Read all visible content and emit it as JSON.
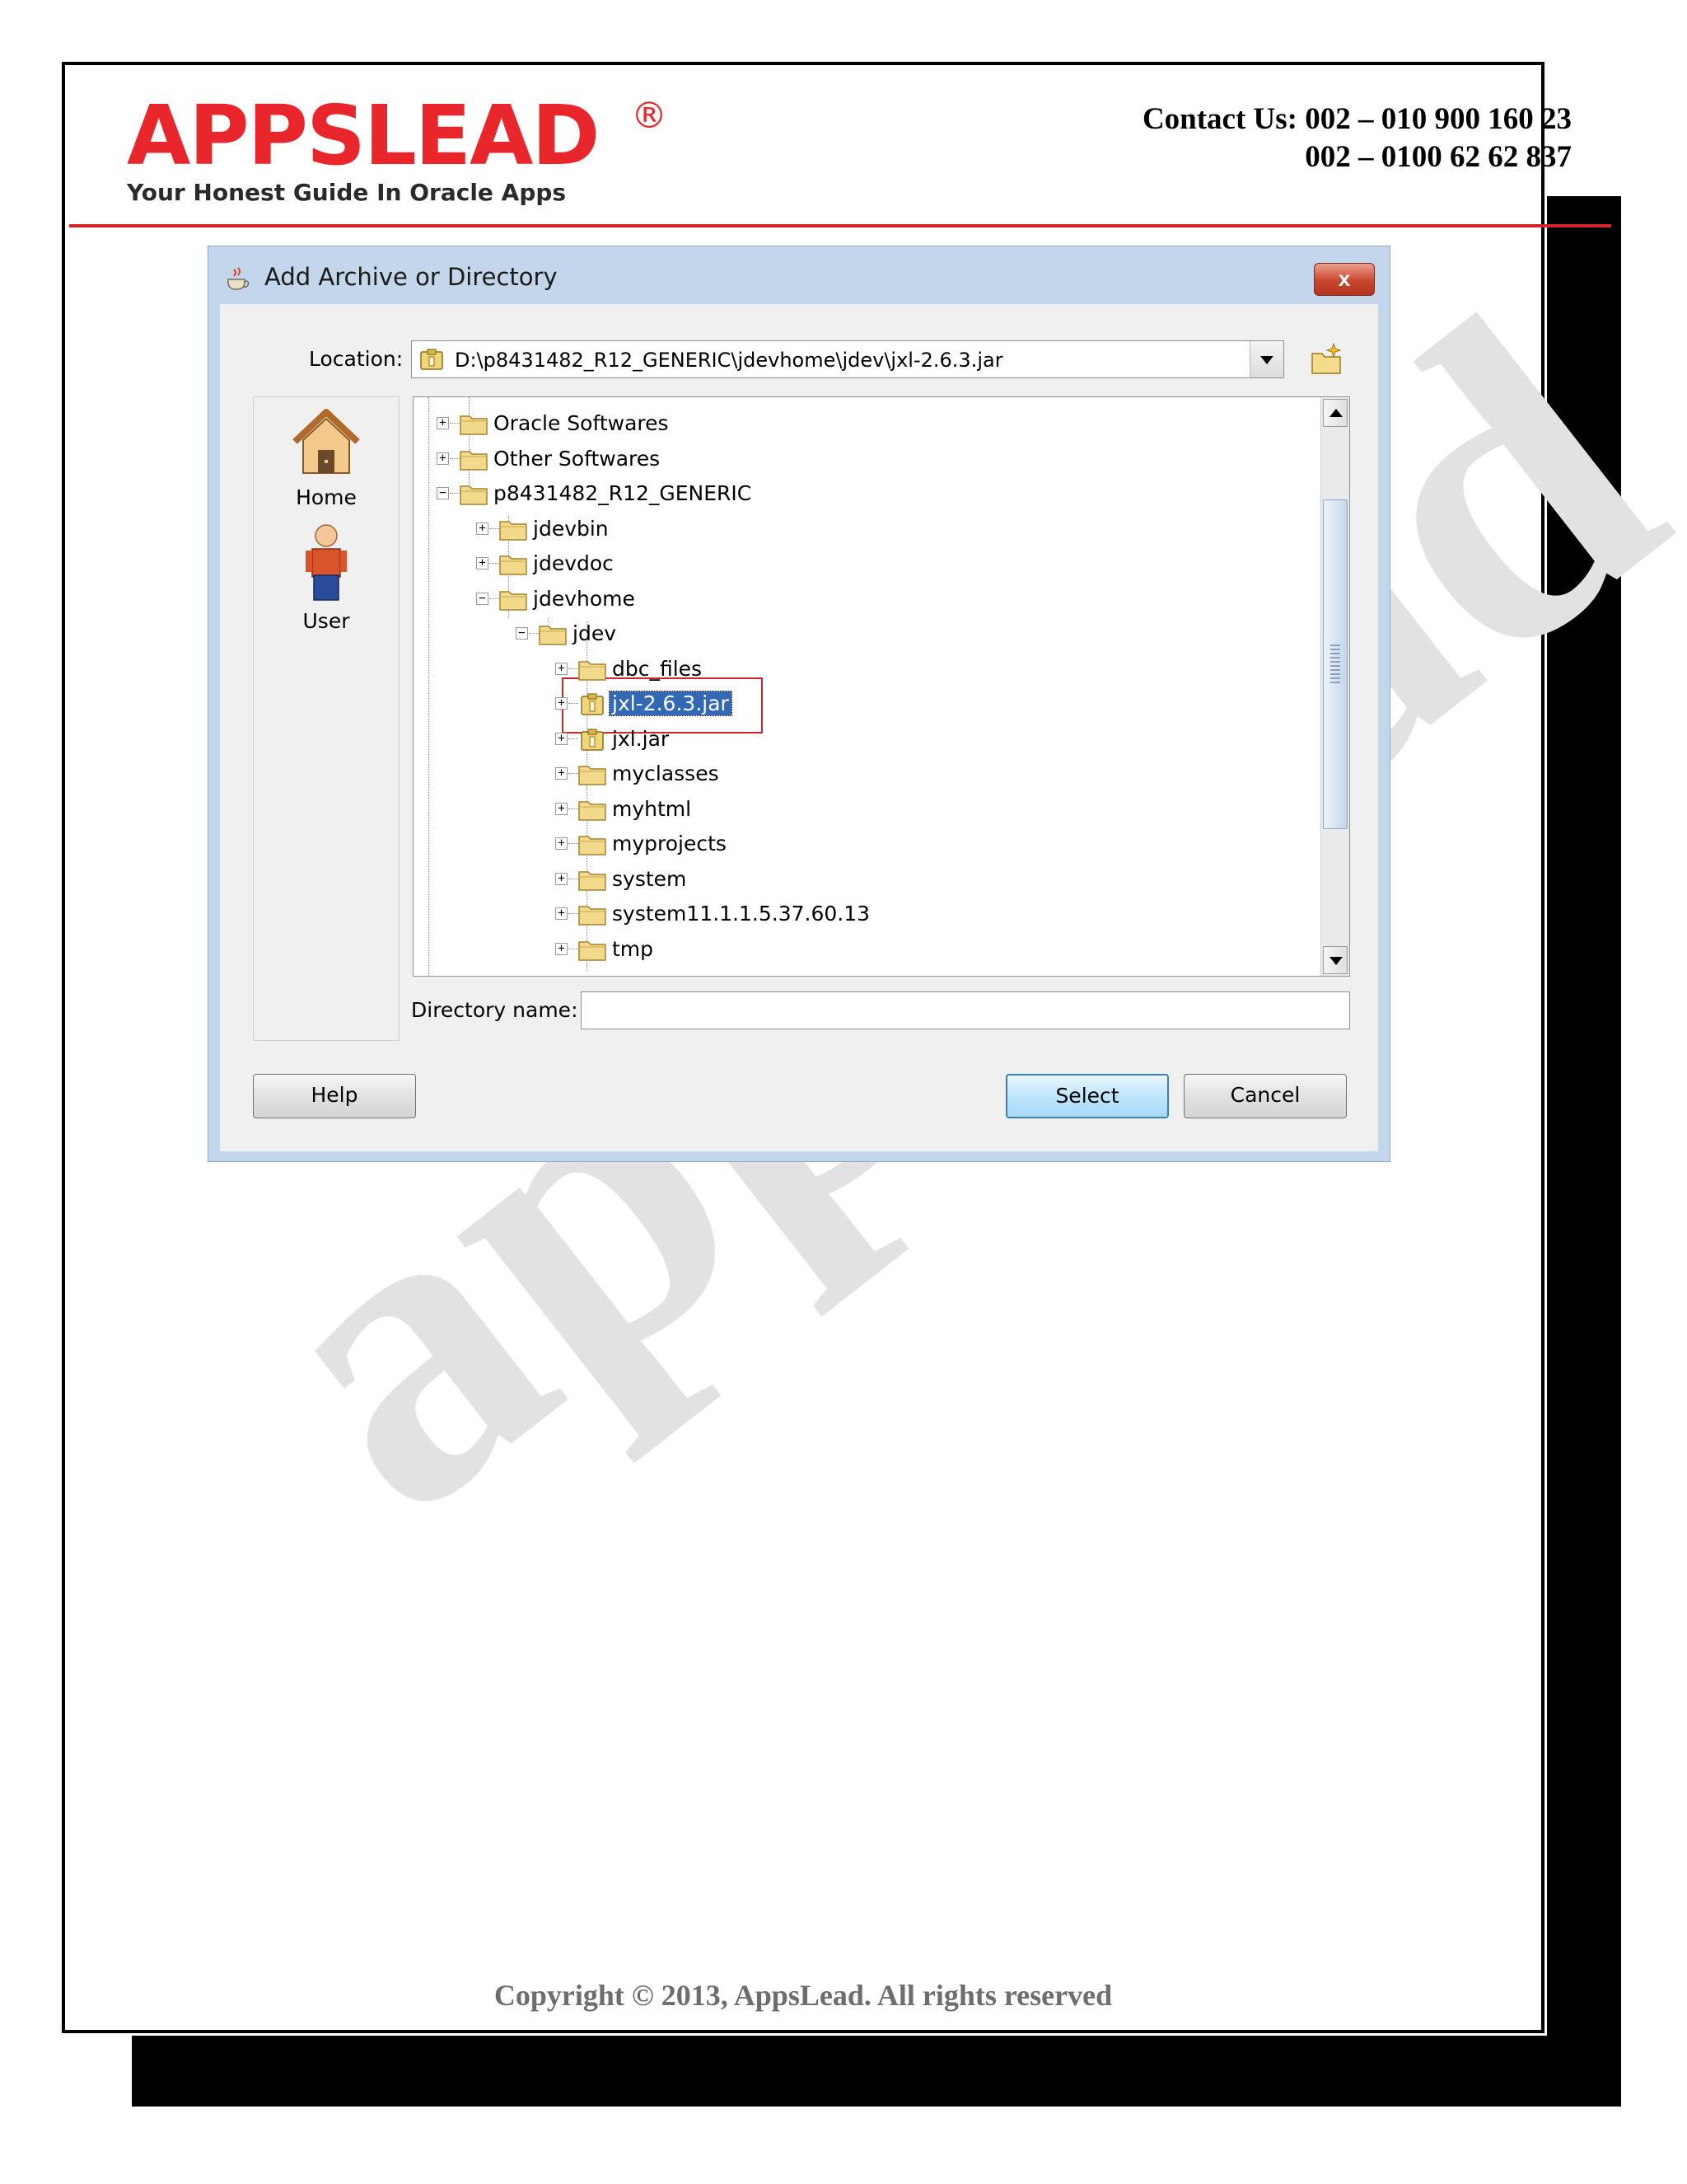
{
  "header": {
    "logo_text": "APPSLEAD",
    "logo_registered": "®",
    "tagline": "Your Honest Guide In Oracle Apps",
    "contact_line1": "Contact Us: 002 – 010 900 160 23",
    "contact_line2": "002 – 0100 62 62 837",
    "brand_color": "#e8262b"
  },
  "watermark": "appslead",
  "footer": {
    "copyright": "Copyright © 2013, AppsLead. All rights reserved"
  },
  "dialog": {
    "title": "Add Archive or Directory",
    "close_label": "x",
    "location_label": "Location:",
    "location_value": "D:\\p8431482_R12_GENERIC\\jdevhome\\jdev\\jxl-2.6.3.jar",
    "places": [
      {
        "label": "Home",
        "icon": "home-icon"
      },
      {
        "label": "User",
        "icon": "user-icon"
      }
    ],
    "tree": [
      {
        "label": "Oracle Softwares",
        "level": 0,
        "expander": "+",
        "icon": "folder-icon"
      },
      {
        "label": "Other Softwares",
        "level": 0,
        "expander": "+",
        "icon": "folder-icon"
      },
      {
        "label": "p8431482_R12_GENERIC",
        "level": 0,
        "expander": "-",
        "icon": "folder-icon"
      },
      {
        "label": "jdevbin",
        "level": 1,
        "expander": "+",
        "icon": "folder-icon"
      },
      {
        "label": "jdevdoc",
        "level": 1,
        "expander": "+",
        "icon": "folder-icon"
      },
      {
        "label": "jdevhome",
        "level": 1,
        "expander": "-",
        "icon": "folder-icon"
      },
      {
        "label": "jdev",
        "level": 2,
        "expander": "-",
        "icon": "folder-icon"
      },
      {
        "label": "dbc_files",
        "level": 3,
        "expander": "+",
        "icon": "folder-icon"
      },
      {
        "label": "jxl-2.6.3.jar",
        "level": 3,
        "expander": "+",
        "icon": "jar-icon",
        "selected": true
      },
      {
        "label": "jxl.jar",
        "level": 3,
        "expander": "+",
        "icon": "jar-icon"
      },
      {
        "label": "myclasses",
        "level": 3,
        "expander": "+",
        "icon": "folder-icon"
      },
      {
        "label": "myhtml",
        "level": 3,
        "expander": "+",
        "icon": "folder-icon"
      },
      {
        "label": "myprojects",
        "level": 3,
        "expander": "+",
        "icon": "folder-icon"
      },
      {
        "label": "system",
        "level": 3,
        "expander": "+",
        "icon": "folder-icon"
      },
      {
        "label": "system11.1.1.5.37.60.13",
        "level": 3,
        "expander": "+",
        "icon": "folder-icon"
      },
      {
        "label": "tmp",
        "level": 3,
        "expander": "+",
        "icon": "folder-icon"
      }
    ],
    "directory_name_label": "Directory name:",
    "directory_name_value": "",
    "buttons": {
      "help": "Help",
      "select": "Select",
      "cancel": "Cancel"
    }
  }
}
